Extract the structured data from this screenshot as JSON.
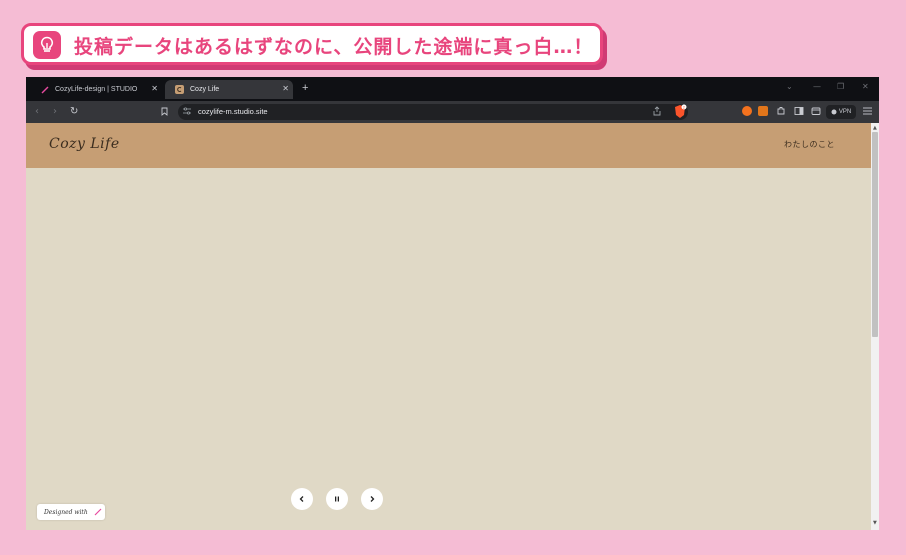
{
  "callout": {
    "text": "投稿データはあるはずなのに、公開した途端に真っ白…！",
    "icon": "lightbulb-icon",
    "color": "#e8457d"
  },
  "browser": {
    "tabs": [
      {
        "label": "CozyLife-design | STUDIO",
        "icon": "studio-pen-icon",
        "active": false
      },
      {
        "label": "Cozy Life",
        "icon": "cozylife-favicon",
        "active": true
      }
    ],
    "new_tab": "+",
    "address": "cozylife-m.studio.site",
    "vpn_label": "VPN"
  },
  "site": {
    "logo": "Cozy Life",
    "nav": [
      "わたしのこと"
    ],
    "header_color": "#c69e74",
    "body_color": "#e0d9c6",
    "badge": "Designed with"
  },
  "slider": {
    "controls": [
      "prev",
      "pause",
      "next"
    ]
  }
}
